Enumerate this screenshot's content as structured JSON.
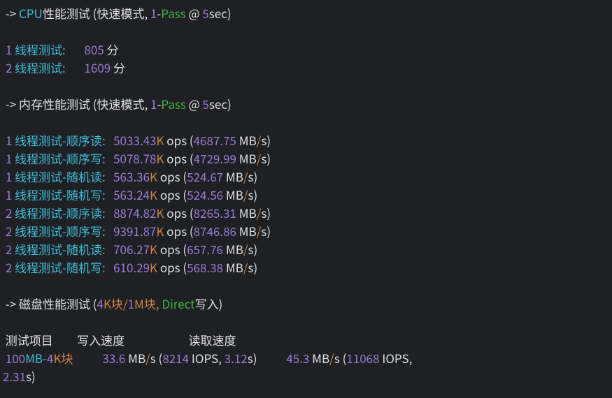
{
  "cpu_header": {
    "arrow": " -> ",
    "label": "CPU",
    "text": "性能测试 (快速模式, ",
    "pass1": "1",
    "dash": "-",
    "pass2": "Pass",
    "at": " @ ",
    "sec": "5",
    "sec_tail": "sec)"
  },
  "cpu_rows": [
    {
      "n": "1",
      "label": " 线程测试:",
      "pad": "       ",
      "val": "805",
      "unit": " 分"
    },
    {
      "n": "2",
      "label": " 线程测试:",
      "pad": "       ",
      "val": "1609",
      "unit": " 分"
    }
  ],
  "mem_header": {
    "arrow": " -> ",
    "text": "内存性能测试 (快速模式, ",
    "pass1": "1",
    "dash": "-",
    "pass2": "Pass",
    "at": " @ ",
    "sec": "5",
    "sec_tail": "sec)"
  },
  "mem_rows": [
    {
      "n": "1",
      "label": " 线程测试-顺序读:",
      "pad": "   ",
      "kops": "5033.43",
      "k": "K",
      "mid": " ops (",
      "mb": "4687.75",
      "tail": " MB",
      "slash": "/",
      "s": "s)"
    },
    {
      "n": "1",
      "label": " 线程测试-顺序写:",
      "pad": "   ",
      "kops": "5078.78",
      "k": "K",
      "mid": " ops (",
      "mb": "4729.99",
      "tail": " MB",
      "slash": "/",
      "s": "s)"
    },
    {
      "n": "1",
      "label": " 线程测试-随机读:",
      "pad": "   ",
      "kops": "563.36",
      "k": "K",
      "mid": " ops (",
      "mb": "524.67",
      "tail": " MB",
      "slash": "/",
      "s": "s)"
    },
    {
      "n": "1",
      "label": " 线程测试-随机写:",
      "pad": "   ",
      "kops": "563.24",
      "k": "K",
      "mid": " ops (",
      "mb": "524.56",
      "tail": " MB",
      "slash": "/",
      "s": "s)"
    },
    {
      "n": "2",
      "label": " 线程测试-顺序读:",
      "pad": "   ",
      "kops": "8874.82",
      "k": "K",
      "mid": " ops (",
      "mb": "8265.31",
      "tail": " MB",
      "slash": "/",
      "s": "s)"
    },
    {
      "n": "2",
      "label": " 线程测试-顺序写:",
      "pad": "   ",
      "kops": "9391.87",
      "k": "K",
      "mid": " ops (",
      "mb": "8746.86",
      "tail": " MB",
      "slash": "/",
      "s": "s)"
    },
    {
      "n": "2",
      "label": " 线程测试-随机读:",
      "pad": "   ",
      "kops": "706.27",
      "k": "K",
      "mid": " ops (",
      "mb": "657.76",
      "tail": " MB",
      "slash": "/",
      "s": "s)"
    },
    {
      "n": "2",
      "label": " 线程测试-随机写:",
      "pad": "   ",
      "kops": "610.29",
      "k": "K",
      "mid": " ops (",
      "mb": "568.38",
      "tail": " MB",
      "slash": "/",
      "s": "s)"
    }
  ],
  "disk_header": {
    "arrow": " -> ",
    "text": "磁盘性能测试 (",
    "b4k": "4",
    "b4kl": "K块",
    "slash": "/",
    "b1m": "1",
    "b1ml": "M块, ",
    "direct": "Direct",
    "tail": "写入)"
  },
  "disk_cols": {
    "c1": " 测试项目",
    "pad1": "         ",
    "c2": "写入速度",
    "pad2": "                        ",
    "c3": "读取速度"
  },
  "disk_row": {
    "name1": " 100",
    "name2": "MB-",
    "name3": "4",
    "name4": "K块",
    "pad1": "           ",
    "w_v": "33.6",
    "w_mb": " MB",
    "w_slash": "/",
    "w_s": "s (",
    "w_iops": "8214",
    "w_iops_l": " IOPS, ",
    "w_t": "3.12",
    "w_tl": "s)",
    "pad2": "           ",
    "r_v": "45.3",
    "r_mb": " MB",
    "r_slash": "/",
    "r_s": "s (",
    "r_iops": "11068",
    "r_iops_l": " IOPS,"
  },
  "disk_row2": {
    "t": "2.31",
    "tl": "s)"
  },
  "blank": " "
}
